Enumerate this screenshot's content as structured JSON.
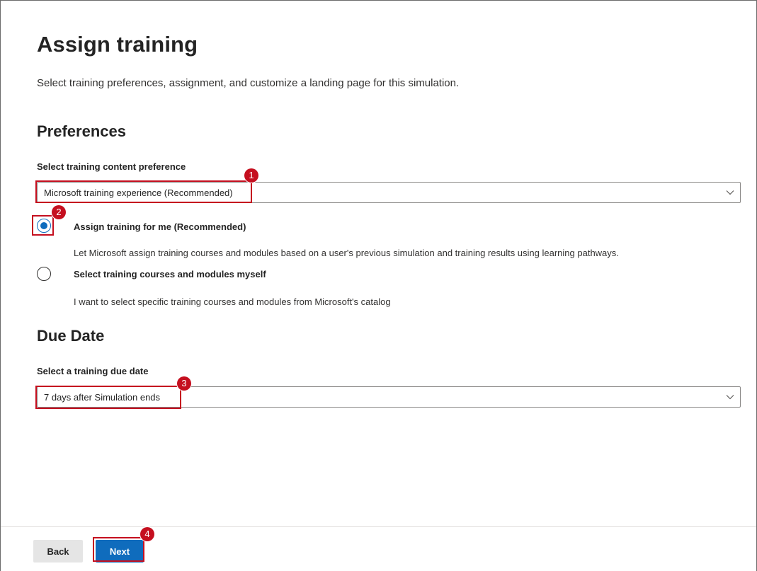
{
  "page": {
    "title": "Assign training",
    "description": "Select training preferences, assignment, and customize a landing page for this simulation."
  },
  "preferences": {
    "section_title": "Preferences",
    "content_label": "Select training content preference",
    "content_value": "Microsoft training experience (Recommended)",
    "options": [
      {
        "label": "Assign training for me (Recommended)",
        "description": "Let Microsoft assign training courses and modules based on a user's previous simulation and training results using learning pathways.",
        "selected": true
      },
      {
        "label": "Select training courses and modules myself",
        "description": "I want to select specific training courses and modules from Microsoft's catalog",
        "selected": false
      }
    ]
  },
  "due_date": {
    "section_title": "Due Date",
    "label": "Select a training due date",
    "value": "7 days after Simulation ends"
  },
  "footer": {
    "back_label": "Back",
    "next_label": "Next"
  },
  "callouts": [
    "1",
    "2",
    "3",
    "4"
  ],
  "colors": {
    "accent": "#0f6cbd",
    "callout": "#c50f1f"
  },
  "icons": {
    "dropdown": "chevron-down-icon"
  }
}
